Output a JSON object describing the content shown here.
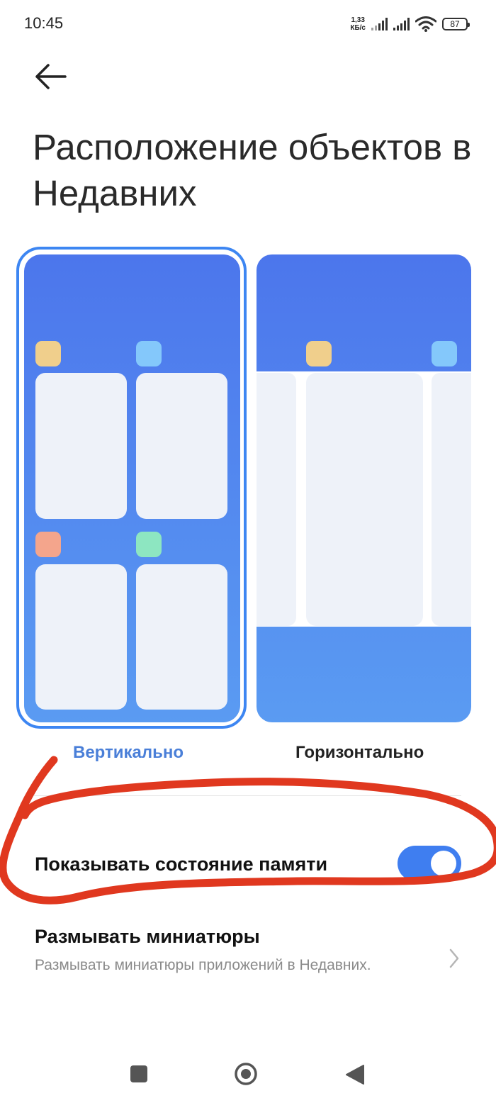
{
  "status_bar": {
    "time": "10:45",
    "net_speed_value": "1,33",
    "net_speed_unit": "КБ/с",
    "battery": "87"
  },
  "page": {
    "title": "Расположение объектов в Недавних"
  },
  "layout_options": [
    {
      "label": "Вертикально",
      "selected": true
    },
    {
      "label": "Горизонтально",
      "selected": false
    }
  ],
  "settings": {
    "memory": {
      "label": "Показывать состояние памяти",
      "enabled": true
    },
    "blur": {
      "label": "Размывать миниатюры",
      "description": "Размывать миниатюры приложений в Недавних."
    }
  },
  "colors": {
    "accent": "#3f7ef0",
    "selected_label": "#4a7fd8",
    "preview_top": "#4c76ec",
    "preview_bottom": "#5a9bf2",
    "annotation_red": "#e0381f",
    "app_yellow": "#f0cf8c",
    "app_blue": "#84c8fb",
    "app_orange": "#f4a58c",
    "app_green": "#8de6c1"
  },
  "icons": {
    "back": "arrow-left-icon",
    "wifi": "wifi-icon",
    "chevron": "chevron-right-icon",
    "nav_recent": "square-icon",
    "nav_home": "circle-icon",
    "nav_back": "triangle-left-icon"
  }
}
